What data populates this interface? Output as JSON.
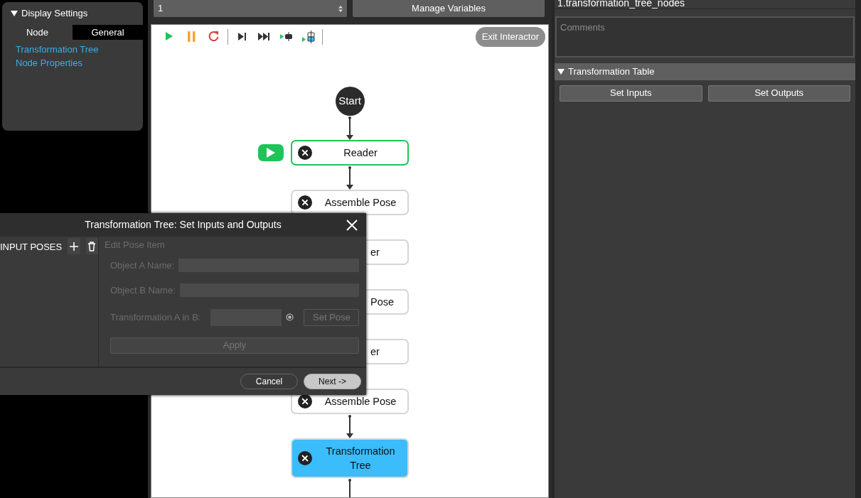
{
  "left_panel": {
    "title": "Display Settings",
    "expanded": true,
    "tabs": [
      {
        "label": "Node",
        "selected": true
      },
      {
        "label": "General",
        "selected": false
      }
    ],
    "links": [
      "Transformation Tree",
      "Node Properties"
    ]
  },
  "top_bar": {
    "dropdown_value": "1",
    "button": "Manage Variables"
  },
  "toolbar": {
    "exit_button": "Exit Interactor"
  },
  "flow": {
    "start_label": "Start",
    "nodes": [
      {
        "label": "Reader",
        "kind": "full",
        "running": true,
        "selected": false
      },
      {
        "label": "Assemble Pose",
        "kind": "full",
        "running": false,
        "selected": false
      },
      {
        "label": "er",
        "kind": "covered",
        "running": false,
        "selected": false
      },
      {
        "label": "Pose",
        "kind": "covered",
        "running": false,
        "selected": false
      },
      {
        "label": "er",
        "kind": "covered",
        "running": false,
        "selected": false
      },
      {
        "label": "Assemble Pose",
        "kind": "full",
        "running": false,
        "selected": false
      },
      {
        "label": "Transformation Tree",
        "kind": "full",
        "running": false,
        "selected": true
      }
    ]
  },
  "right_panel": {
    "title": "1.transformation_tree_nodes",
    "comments_placeholder": "Comments",
    "section": {
      "title": "Transformation Table",
      "expanded": true
    },
    "buttons": [
      "Set Inputs",
      "Set Outputs"
    ]
  },
  "dialog": {
    "title": "Transformation Tree: Set Inputs and Outputs",
    "list_header": "INPUT POSES",
    "editor": {
      "title": "Edit Pose Item",
      "disabled": true,
      "fields": [
        {
          "label": "Object A Name:",
          "kind": "text"
        },
        {
          "label": "Object B Name:",
          "kind": "text"
        },
        {
          "label": "Transformation A in B:",
          "kind": "pose",
          "button": "Set Pose"
        }
      ],
      "apply": "Apply"
    },
    "buttons": [
      {
        "label": "Cancel",
        "primary": false
      },
      {
        "label": "Next ->",
        "primary": true
      }
    ]
  }
}
